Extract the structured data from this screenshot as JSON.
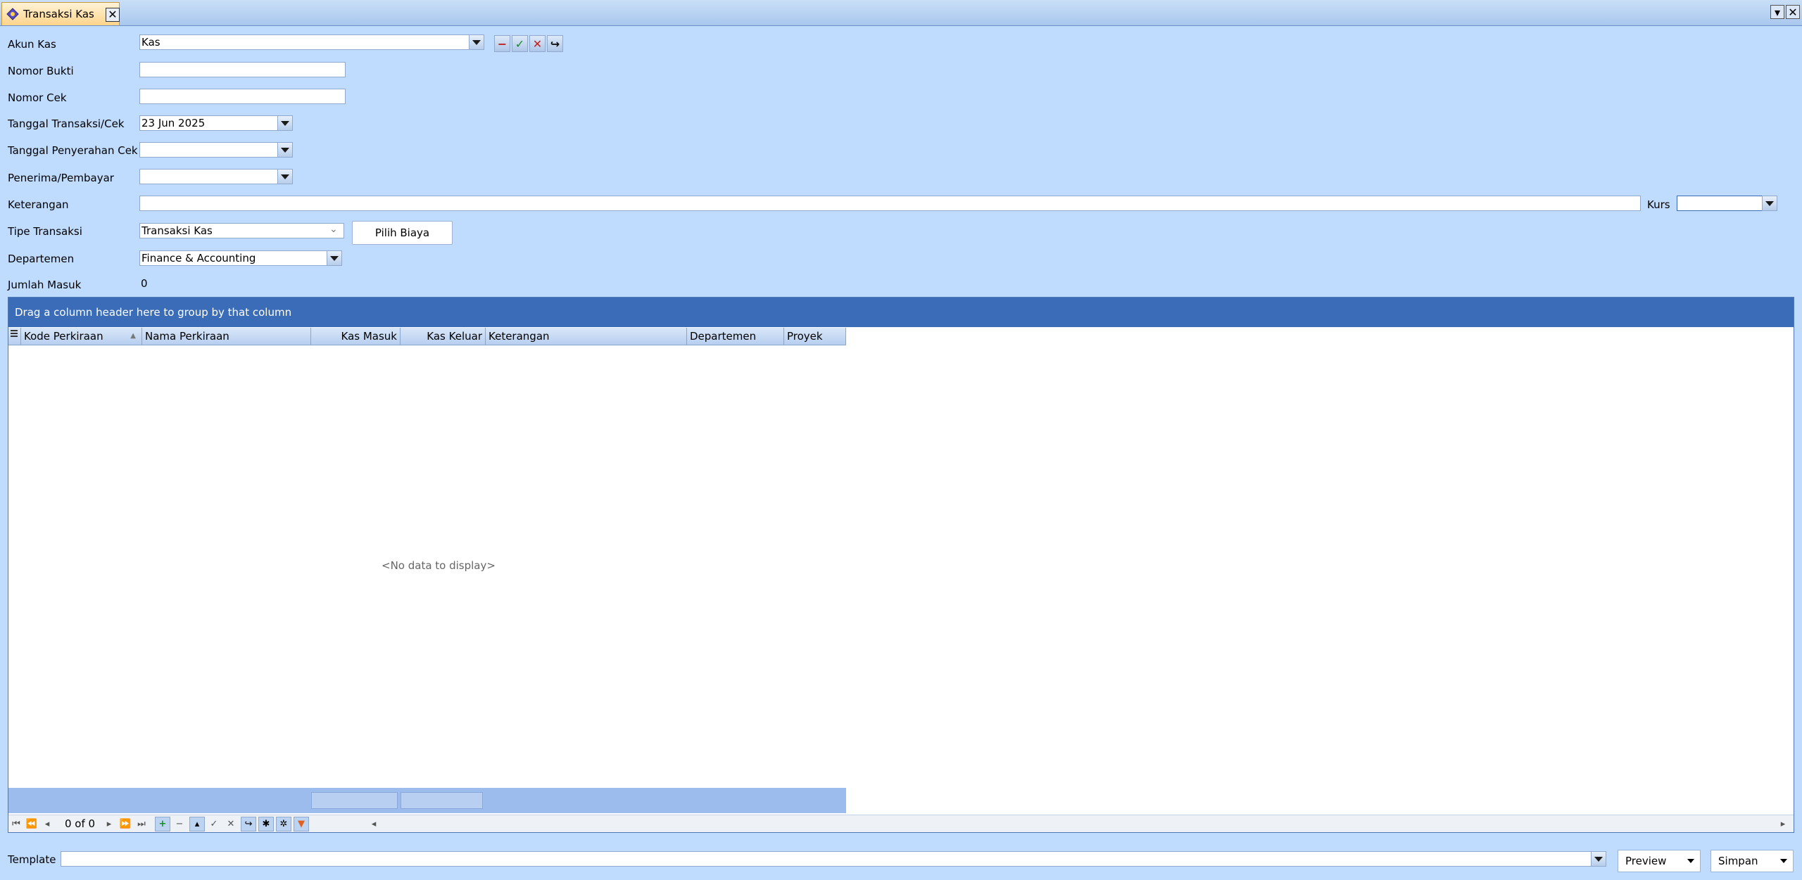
{
  "tab": {
    "title": "Transaksi Kas",
    "close": "✕"
  },
  "window": {
    "dropdown": "▾",
    "close": "✕"
  },
  "form": {
    "akun_kas": {
      "label": "Akun Kas",
      "value": "Kas"
    },
    "nomor_bukti": {
      "label": "Nomor Bukti",
      "value": ""
    },
    "nomor_cek": {
      "label": "Nomor Cek",
      "value": ""
    },
    "tanggal_transaksi": {
      "label": "Tanggal Transaksi/Cek",
      "value": "23 Jun 2025"
    },
    "tanggal_penyerahan": {
      "label": "Tanggal Penyerahan Cek",
      "value": ""
    },
    "penerima": {
      "label": "Penerima/Pembayar",
      "value": ""
    },
    "keterangan": {
      "label": "Keterangan",
      "value": ""
    },
    "kurs": {
      "label": "Kurs",
      "value": ""
    },
    "tipe_transaksi": {
      "label": "Tipe Transaksi",
      "value": "Transaksi Kas"
    },
    "pilih_biaya": "Pilih Biaya",
    "departemen": {
      "label": "Departemen",
      "value": "Finance & Accounting"
    },
    "jumlah_masuk": {
      "label": "Jumlah Masuk",
      "value": "0"
    }
  },
  "toolbar_icons": [
    "minus-icon",
    "check-icon",
    "cancel-icon",
    "refresh-icon"
  ],
  "grid": {
    "group_hint": "Drag a column header here to group by that column",
    "columns": [
      "Kode Perkiraan",
      "Nama Perkiraan",
      "Kas Masuk",
      "Kas Keluar",
      "Keterangan",
      "Departemen",
      "Proyek"
    ],
    "sort_indicator": "▲",
    "empty_text": "<No data to display>",
    "navigator": {
      "count": "0 of 0"
    }
  },
  "bottom": {
    "template_label": "Template",
    "template_value": "",
    "preview": "Preview",
    "simpan": "Simpan"
  },
  "colors": {
    "accent": "#3a6cb8",
    "background": "#bfdbfe",
    "tab_active": "#ffd48a"
  }
}
